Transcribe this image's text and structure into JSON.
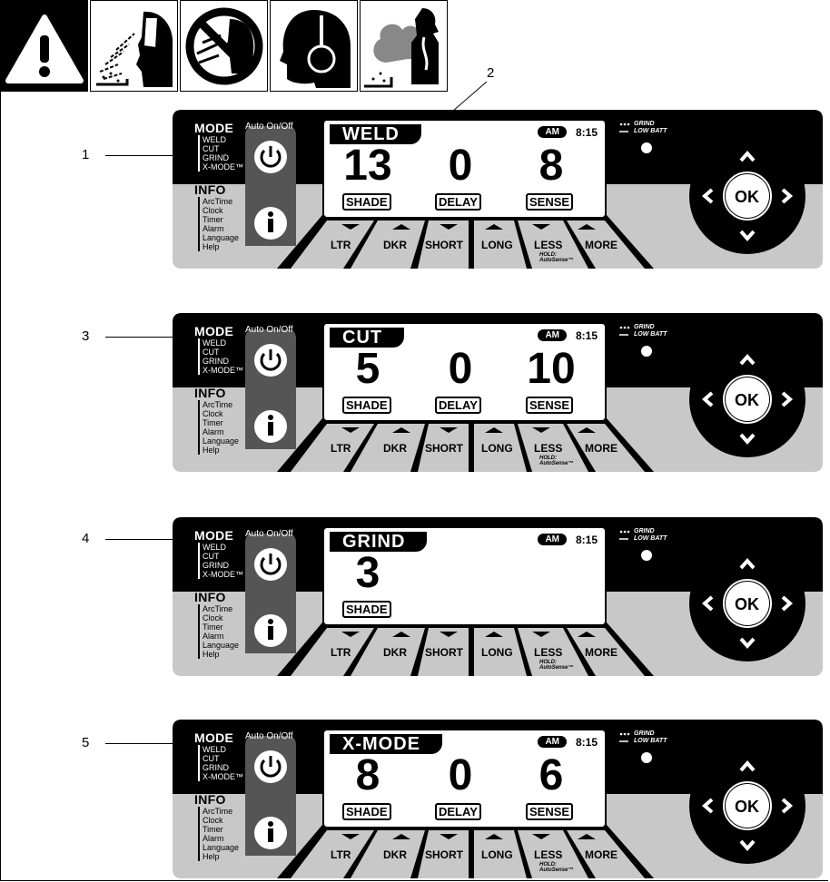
{
  "callouts": [
    "1",
    "2",
    "3",
    "4",
    "5"
  ],
  "panels": [
    {
      "mode_header": "MODE",
      "auto_on_off": "Auto On/Off",
      "mode_items": [
        "WELD",
        "CUT",
        "GRIND",
        "X-MODE™"
      ],
      "info_header": "INFO",
      "info_items": [
        "ArcTime",
        "Clock",
        "Timer",
        "Alarm",
        "Language",
        "Help"
      ],
      "mode": "WELD",
      "am": "AM",
      "time": "8:15",
      "values": [
        {
          "value": "13",
          "label": "SHADE"
        },
        {
          "value": "0",
          "label": "DELAY"
        },
        {
          "value": "8",
          "label": "SENSE"
        }
      ],
      "buttons": [
        "LTR",
        "DKR",
        "SHORT",
        "LONG",
        "LESS",
        "MORE"
      ],
      "hold_text": "HOLD:",
      "autosense_text": "AutoSense™",
      "grind_indicator": "GRIND",
      "low_batt": "LOW BATT",
      "ok": "OK"
    },
    {
      "mode_header": "MODE",
      "auto_on_off": "Auto On/Off",
      "mode_items": [
        "WELD",
        "CUT",
        "GRIND",
        "X-MODE™"
      ],
      "info_header": "INFO",
      "info_items": [
        "ArcTime",
        "Clock",
        "Timer",
        "Alarm",
        "Language",
        "Help"
      ],
      "mode": "CUT",
      "am": "AM",
      "time": "8:15",
      "values": [
        {
          "value": "5",
          "label": "SHADE"
        },
        {
          "value": "0",
          "label": "DELAY"
        },
        {
          "value": "10",
          "label": "SENSE"
        }
      ],
      "buttons": [
        "LTR",
        "DKR",
        "SHORT",
        "LONG",
        "LESS",
        "MORE"
      ],
      "hold_text": "HOLD:",
      "autosense_text": "AutoSense™",
      "grind_indicator": "GRIND",
      "low_batt": "LOW BATT",
      "ok": "OK"
    },
    {
      "mode_header": "MODE",
      "auto_on_off": "Auto On/Off",
      "mode_items": [
        "WELD",
        "CUT",
        "GRIND",
        "X-MODE™"
      ],
      "info_header": "INFO",
      "info_items": [
        "ArcTime",
        "Clock",
        "Timer",
        "Alarm",
        "Language",
        "Help"
      ],
      "mode": "GRIND",
      "am": "AM",
      "time": "8:15",
      "values": [
        {
          "value": "3",
          "label": "SHADE"
        }
      ],
      "buttons": [
        "LTR",
        "DKR",
        "SHORT",
        "LONG",
        "LESS",
        "MORE"
      ],
      "hold_text": "HOLD:",
      "autosense_text": "AutoSense™",
      "grind_indicator": "GRIND",
      "low_batt": "LOW BATT",
      "ok": "OK"
    },
    {
      "mode_header": "MODE",
      "auto_on_off": "Auto On/Off",
      "mode_items": [
        "WELD",
        "CUT",
        "GRIND",
        "X-MODE™"
      ],
      "info_header": "INFO",
      "info_items": [
        "ArcTime",
        "Clock",
        "Timer",
        "Alarm",
        "Language",
        "Help"
      ],
      "mode": "X-MODE",
      "am": "AM",
      "time": "8:15",
      "values": [
        {
          "value": "8",
          "label": "SHADE"
        },
        {
          "value": "0",
          "label": "DELAY"
        },
        {
          "value": "6",
          "label": "SENSE"
        }
      ],
      "buttons": [
        "LTR",
        "DKR",
        "SHORT",
        "LONG",
        "LESS",
        "MORE"
      ],
      "hold_text": "HOLD:",
      "autosense_text": "AutoSense™",
      "grind_indicator": "GRIND",
      "low_batt": "LOW BATT",
      "ok": "OK"
    }
  ]
}
